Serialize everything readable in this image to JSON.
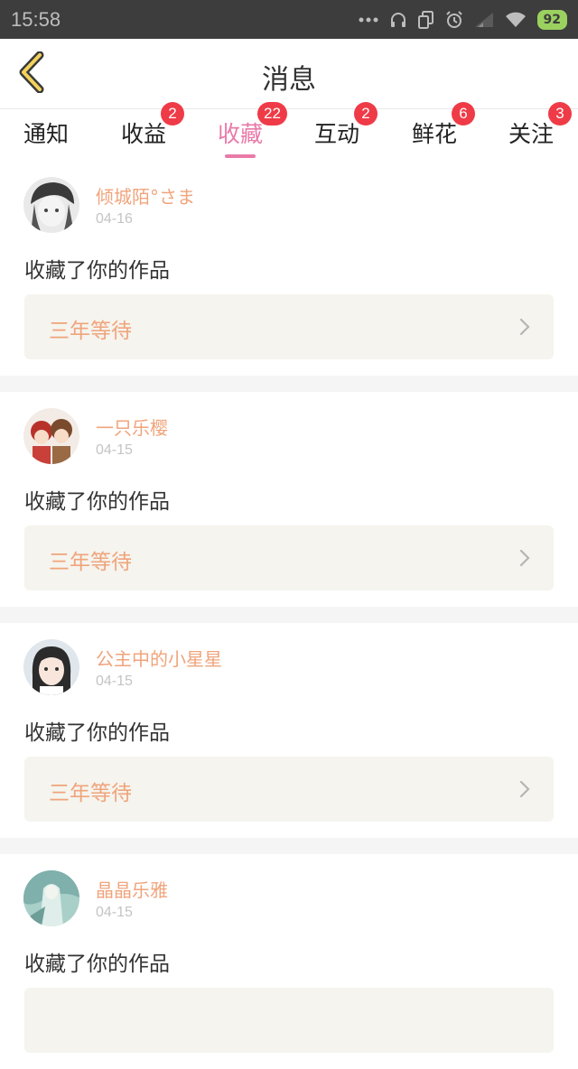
{
  "status_bar": {
    "time": "15:58",
    "battery": "92",
    "icons": [
      "more-dots-icon",
      "headset-icon",
      "copy-icon",
      "alarm-icon",
      "signal-icon",
      "wifi-icon",
      "battery-icon"
    ]
  },
  "header": {
    "title": "消息",
    "back_icon": "chevron-left-icon"
  },
  "tabs": [
    {
      "label": "通知",
      "badge": ""
    },
    {
      "label": "收益",
      "badge": "2"
    },
    {
      "label": "收藏",
      "badge": "22",
      "active": true
    },
    {
      "label": "互动",
      "badge": "2"
    },
    {
      "label": "鲜花",
      "badge": "6"
    },
    {
      "label": "关注",
      "badge": "3"
    }
  ],
  "colors": {
    "accent": "#e97aa9",
    "badge": "#ef3b47",
    "username": "#f0a47c",
    "work_box": "#f5f4ee"
  },
  "messages": [
    {
      "username": "倾城陌°さま",
      "date": "04-16",
      "action": "收藏了你的作品",
      "work": "三年等待"
    },
    {
      "username": "一只乐樱",
      "date": "04-15",
      "action": "收藏了你的作品",
      "work": "三年等待"
    },
    {
      "username": "公主中的小星星",
      "date": "04-15",
      "action": "收藏了你的作品",
      "work": "三年等待"
    },
    {
      "username": "晶晶乐雅",
      "date": "04-15",
      "action": "收藏了你的作品",
      "work": ""
    }
  ]
}
